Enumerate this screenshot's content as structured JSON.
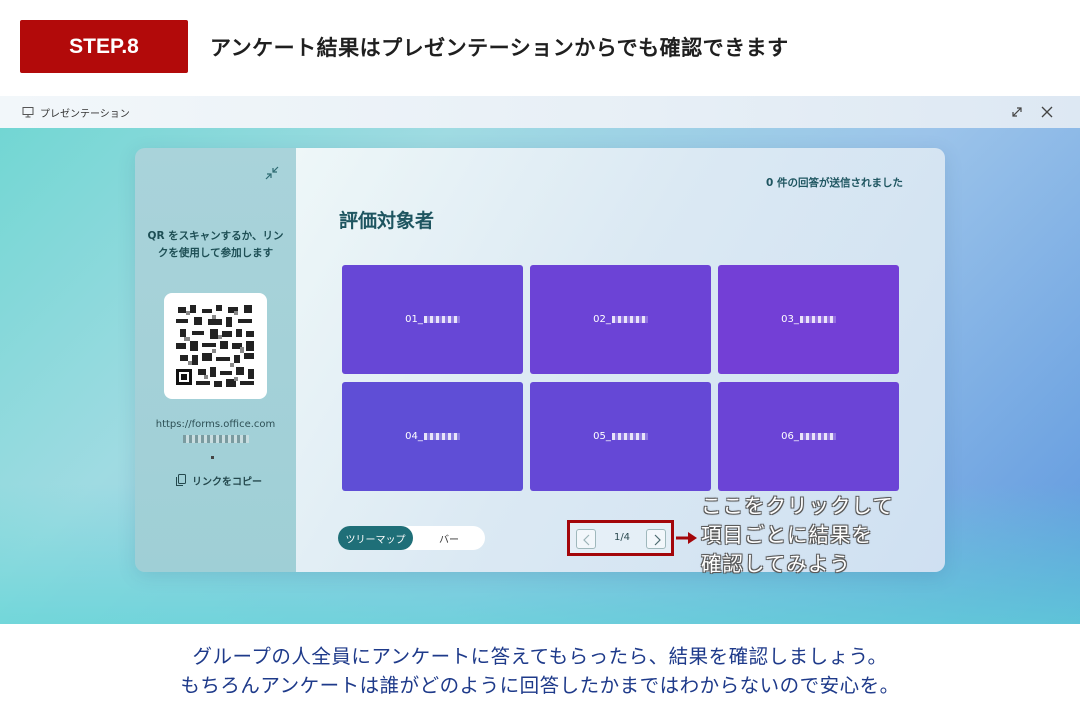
{
  "header": {
    "step_label": "STEP.8",
    "title": "アンケート結果はプレゼンテーションからでも確認できます"
  },
  "window": {
    "title": "プレゼンテーション"
  },
  "sidebar": {
    "scan_text": "QR をスキャンするか、リンクを使用して参加します",
    "url_text": "https://forms.office.com",
    "copy_link_label": "リンクをコピー"
  },
  "main": {
    "response_count": "0 件の回答が送信されました",
    "heading": "評価対象者",
    "tiles": [
      "01_",
      "02_",
      "03_",
      "04_",
      "05_",
      "06_"
    ],
    "toggle": {
      "treemap": "ツリーマップ",
      "bar": "バー"
    },
    "pager": {
      "label": "1/4"
    }
  },
  "annotation": {
    "text": "ここをクリックして\n項目ごとに結果を\n確認してみよう"
  },
  "caption": {
    "line1": "グループの人全員にアンケートに答えてもらったら、結果を確認しましょう。",
    "line2": "もちろんアンケートは誰がどのように回答したかまではわからないので安心を。"
  },
  "colors": {
    "step_badge": "#b20a0a",
    "tile": "#6a44d4",
    "toggle_active": "#1f6f78",
    "highlight": "#a3060a",
    "caption": "#1e3a8a"
  },
  "icons": [
    "presentation-icon",
    "expand-icon",
    "close-icon",
    "collapse-icon",
    "copy-icon",
    "chevron-left-icon",
    "chevron-right-icon",
    "arrow-right-icon"
  ]
}
